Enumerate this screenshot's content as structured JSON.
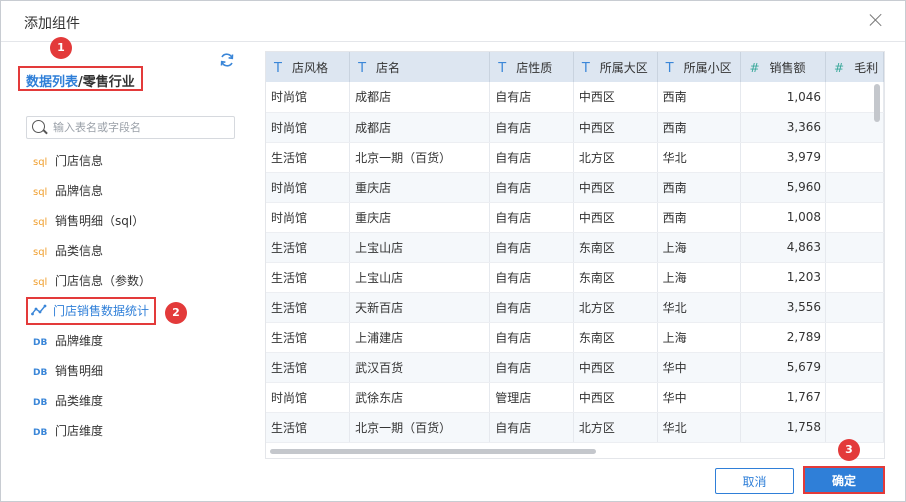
{
  "dialog": {
    "title": "添加组件"
  },
  "left": {
    "breadcrumb": {
      "db": "数据列表",
      "sep": "/",
      "name": "零售行业"
    },
    "search_placeholder": "输入表名或字段名",
    "items": [
      {
        "tag": "sql",
        "label": "门店信息"
      },
      {
        "tag": "sql",
        "label": "品牌信息"
      },
      {
        "tag": "sql",
        "label": "销售明细（sql）"
      },
      {
        "tag": "sql",
        "label": "品类信息"
      },
      {
        "tag": "sql",
        "label": "门店信息（参数）"
      },
      {
        "tag": "",
        "label": "门店销售数据统计"
      },
      {
        "tag": "DB",
        "label": "品牌维度"
      },
      {
        "tag": "DB",
        "label": "销售明细"
      },
      {
        "tag": "DB",
        "label": "品类维度"
      },
      {
        "tag": "DB",
        "label": "门店维度"
      }
    ]
  },
  "badges": [
    "1",
    "2",
    "3"
  ],
  "table": {
    "columns": [
      {
        "type": "T",
        "label": "店风格"
      },
      {
        "type": "T",
        "label": "店名"
      },
      {
        "type": "T",
        "label": "店性质"
      },
      {
        "type": "T",
        "label": "所属大区"
      },
      {
        "type": "T",
        "label": "所属小区"
      },
      {
        "type": "#",
        "label": "销售额"
      },
      {
        "type": "#",
        "label": "毛利"
      }
    ],
    "rows": [
      [
        "时尚馆",
        "成都店",
        "自有店",
        "中西区",
        "西南",
        "1,046",
        ""
      ],
      [
        "时尚馆",
        "成都店",
        "自有店",
        "中西区",
        "西南",
        "3,366",
        ""
      ],
      [
        "生活馆",
        "北京一期（百货）",
        "自有店",
        "北方区",
        "华北",
        "3,979",
        ""
      ],
      [
        "时尚馆",
        "重庆店",
        "自有店",
        "中西区",
        "西南",
        "5,960",
        ""
      ],
      [
        "时尚馆",
        "重庆店",
        "自有店",
        "中西区",
        "西南",
        "1,008",
        ""
      ],
      [
        "生活馆",
        "上宝山店",
        "自有店",
        "东南区",
        "上海",
        "4,863",
        ""
      ],
      [
        "生活馆",
        "上宝山店",
        "自有店",
        "东南区",
        "上海",
        "1,203",
        ""
      ],
      [
        "生活馆",
        "天新百店",
        "自有店",
        "北方区",
        "华北",
        "3,556",
        ""
      ],
      [
        "生活馆",
        "上浦建店",
        "自有店",
        "东南区",
        "上海",
        "2,789",
        ""
      ],
      [
        "生活馆",
        "武汉百货",
        "自有店",
        "中西区",
        "华中",
        "5,679",
        ""
      ],
      [
        "时尚馆",
        "武徐东店",
        "管理店",
        "中西区",
        "华中",
        "1,767",
        ""
      ],
      [
        "生活馆",
        "北京一期（百货）",
        "自有店",
        "北方区",
        "华北",
        "1,758",
        ""
      ]
    ]
  },
  "footer": {
    "cancel": "取消",
    "ok": "确定"
  },
  "colors": {
    "accent": "#2f7fd8",
    "highlight": "#e33a3a",
    "header_bg": "#dde6f1"
  }
}
